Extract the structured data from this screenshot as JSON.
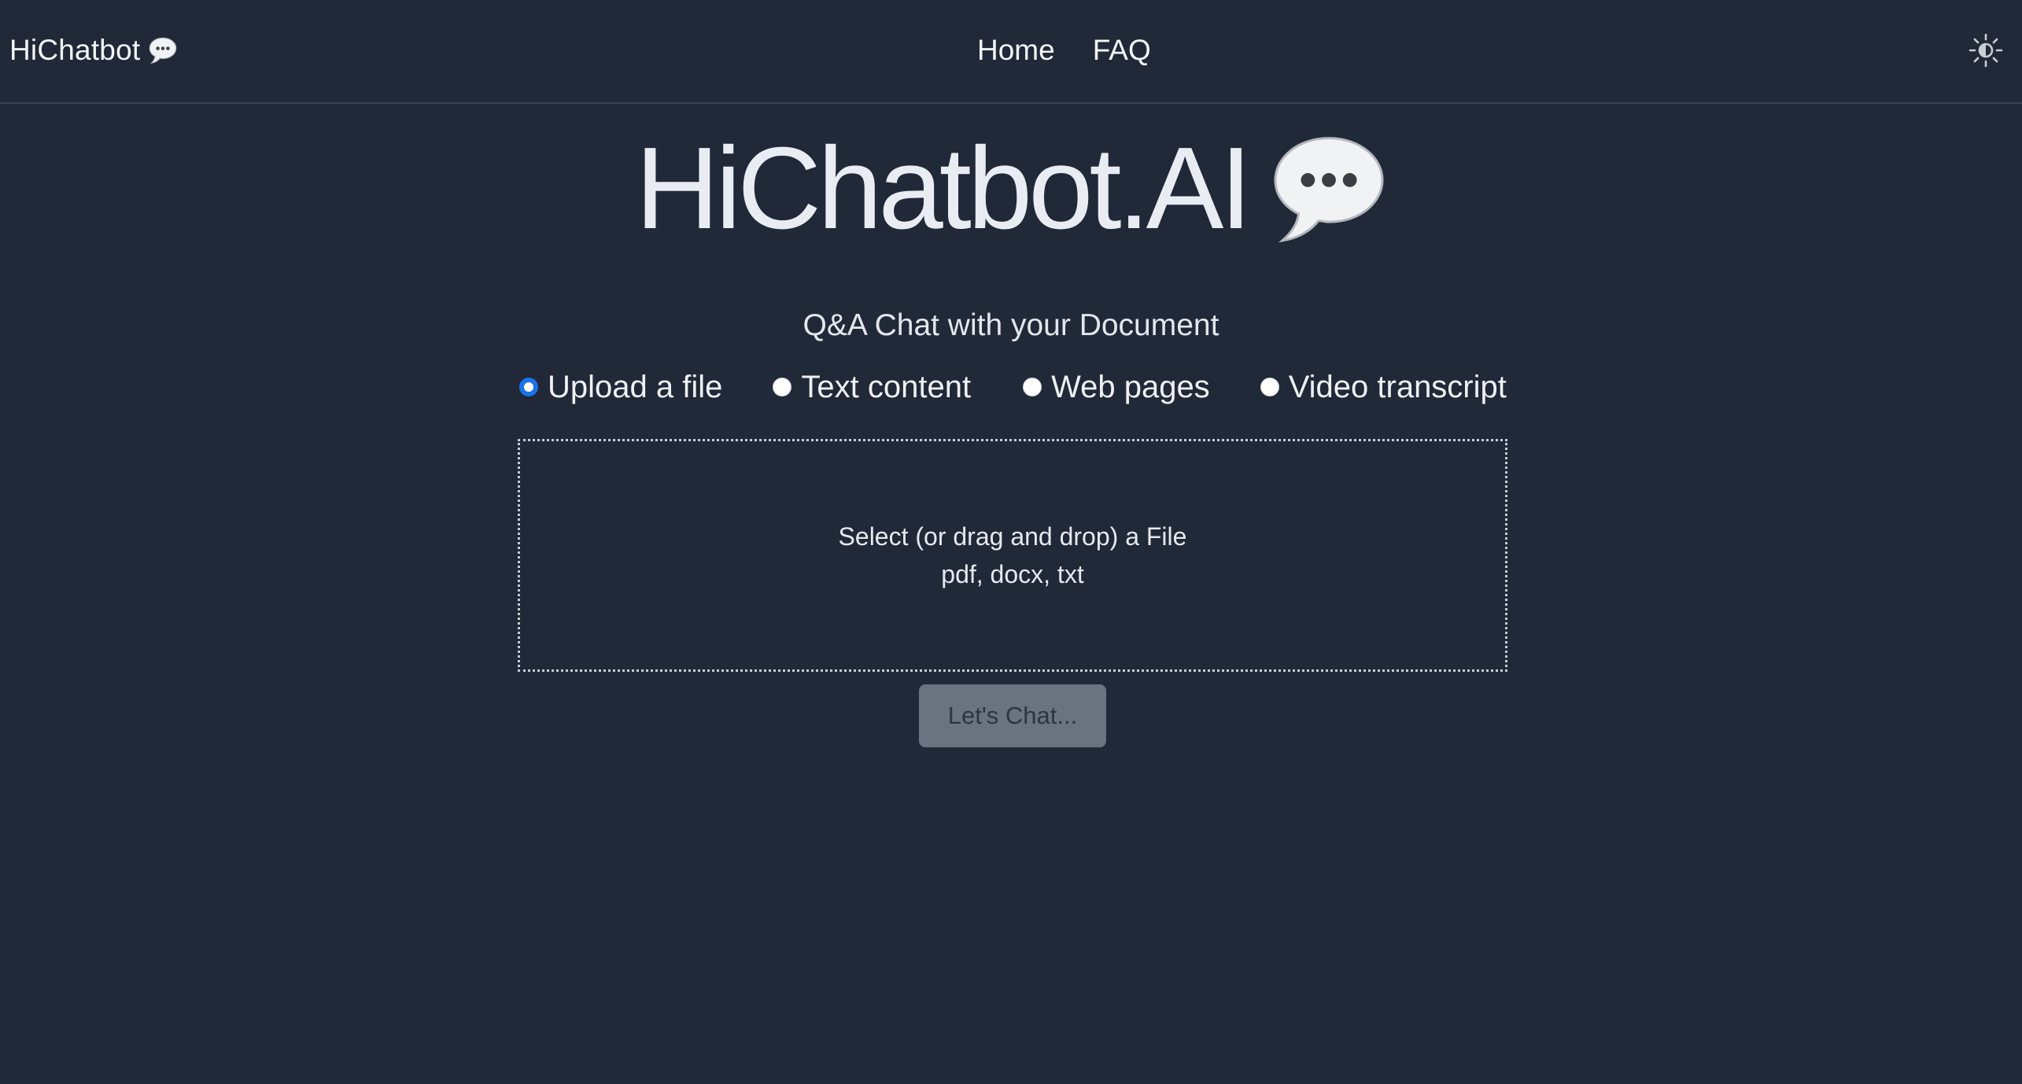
{
  "nav": {
    "brand": "HiChatbot",
    "links": [
      {
        "label": "Home"
      },
      {
        "label": "FAQ"
      }
    ]
  },
  "hero": {
    "title": "HiChatbot.AI"
  },
  "subtitle": "Q&A Chat with your Document",
  "source_options": [
    {
      "label": "Upload a file",
      "checked": true
    },
    {
      "label": "Text content",
      "checked": false
    },
    {
      "label": "Web pages",
      "checked": false
    },
    {
      "label": "Video transcript",
      "checked": false
    }
  ],
  "dropzone": {
    "line1": "Select (or drag and drop) a File",
    "line2": "pdf, docx, txt"
  },
  "chat_button": {
    "label": "Let's Chat..."
  },
  "icons": {
    "brand": "speech-bubble-icon",
    "hero": "speech-bubble-icon",
    "theme": "sun-icon"
  },
  "colors": {
    "background": "#212837",
    "radio_accent": "#1a73e8",
    "button": "#6b7280"
  }
}
